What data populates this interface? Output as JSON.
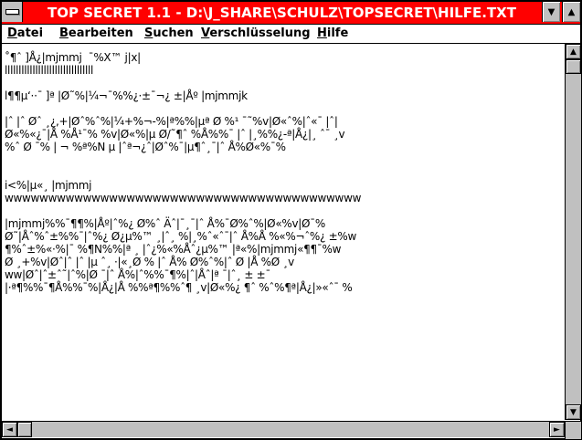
{
  "window": {
    "title": "TOP SECRET 1.1 - D:\\J_SHARE\\SCHULZ\\TOPSECRET\\HILFE.TXT",
    "title_color": "#ff0000",
    "system_menu_icon": "system-menu-bar-icon",
    "minimize_icon": "triangle-down-icon",
    "maximize_icon": "triangle-up-icon"
  },
  "menu": {
    "items": [
      {
        "label": "Datei"
      },
      {
        "label": "Bearbeiten"
      },
      {
        "label": "Suchen"
      },
      {
        "label": "Verschlüsselung"
      },
      {
        "label": "Hilfe"
      }
    ]
  },
  "document": {
    "lines": [
      "˚¶ˆ ]Å¿|mjmmj  ˉ%X™ j|x|",
      "llllllllllllllllllllllllllllllll",
      "",
      "l¶¶µ‘··ˉ ]ª |Ø˜%|¼¬ˉ%%¿·±ˉ¬¿ ±|Åº |mjmmjk",
      "",
      "|ˆ |ˆ Øˆ ¸¿,+|Øˆ%ˆ%|¼+%¬-%|ª%%|µª Ø %¹ ˉ˜%v|Ø«ˆ%|ˆ«ˉ |ˆ|",
      "Ø«%«¿ˉ|Å %Å¹ˉ% %v|Ø«%|µ Ø/˜¶ˆ %Å%%ˉ |ˆ |¸%%¿-ª|Å¿|¸ ˆˉ ¸v",
      "%ˆ Ø ˉ% | ¬ %ª%N µ |ˆª¬¿ˆ|Øˆ%ˉ|µ¶ˆ¸ˉ|ˆ Å%Ø«%ˉ%",
      "",
      "",
      "i<%|µ«¸ |mjmmj",
      "wwwwwwwwwwwwwwwwwwwwwwwwwwwwwwwwwwwwwwwww",
      "",
      "|mjmmj%%ˉ¶¶%|Åº|ˆ%¿ Ø%ˆ Äˆ|ˉ¸ˉ|ˆ Å%ˉØ%ˆ%|Ø«%v|Øˉ%",
      "Ø˜|Åˆ%ˆ±%%ˉ|ˆ%¿ Ø¿µ%™ ¸|ˆ¸ %|¸%ˆ«ˆˉ|ˆ Å%Å %«%¬ˆ%¿ ±%w",
      "¶%ˆ±%«·%|ˉ %¶N%%|ª ¸ |ˆ¿%«%Åˆ¿µ%™ |ª«%|mjmmj«¶¶ˉ%w",
      "Ø ¸+%v|Øˆ|ˆ |ˆ |µ ˆ¸ ·|«¸Ø % |ˆ Å% Ø%ˆ%|ˆ Ø |Å %Ø ¸v",
      "ww|Øˆ|ˆ±ˆ˜|ˆ%|Ø ˉ|ˆ Å%|ˆ%%ˉ¶%|ˆ|Åˆ|ª ˉ|ˆ¸ ± ±ˉ",
      "|·ª¶%%ˉ¶Å%%ˉ%|Å¿|Å %%ª¶%%ˆ¶ ¸v|Ø«%¿ ¶ˆ %ˆ%¶ª|Å¿|»«ˆˉ %"
    ],
    "text_color": "#000000",
    "background_color": "#ffffff"
  },
  "scrollbars": {
    "vertical": {
      "up_icon": "scroll-up-arrow-icon",
      "down_icon": "scroll-down-arrow-icon",
      "position": 0
    },
    "horizontal": {
      "left_icon": "scroll-left-arrow-icon",
      "right_icon": "scroll-right-arrow-icon",
      "position": 0
    },
    "track_color": "#c0c0c0"
  }
}
